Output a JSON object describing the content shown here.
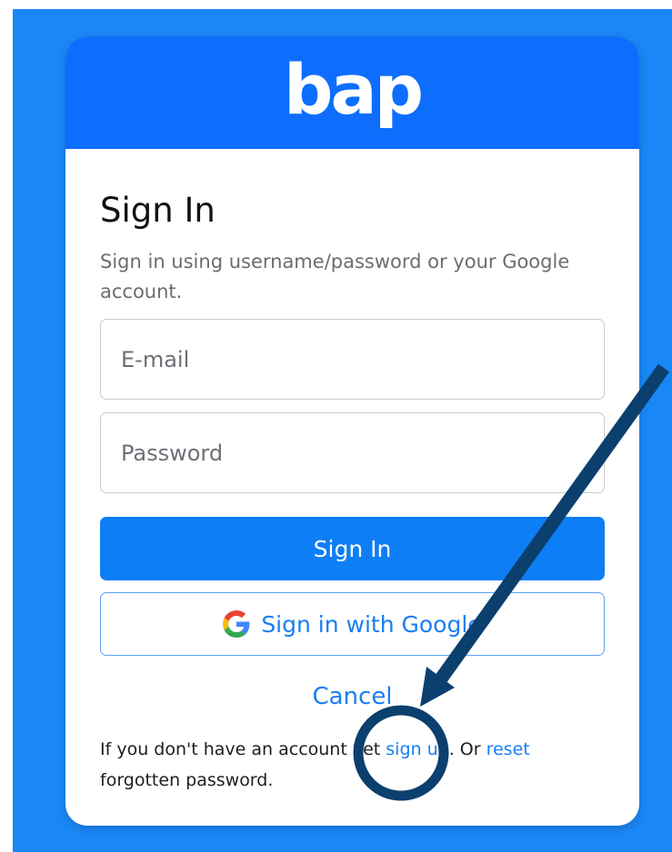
{
  "brand": {
    "logo_text": "bap"
  },
  "signin": {
    "title": "Sign In",
    "subtitle": "Sign in using username/password or your Google account.",
    "email_placeholder": "E-mail",
    "password_placeholder": "Password",
    "signin_button": "Sign In",
    "google_button": "Sign in with Google",
    "cancel_link": "Cancel",
    "note": {
      "prefix": "If you don't have an account yet ",
      "signup_link": "sign up",
      "middle": ". Or ",
      "reset_link": "reset",
      "suffix": " forgotten password."
    }
  },
  "colors": {
    "page_background": "#1a87f6",
    "header": "#0d6efd",
    "primary_button": "#0d7ef5",
    "link": "#1a7ef2",
    "annotation": "#0b3f6e"
  },
  "icons": {
    "google": "google-g-icon"
  }
}
